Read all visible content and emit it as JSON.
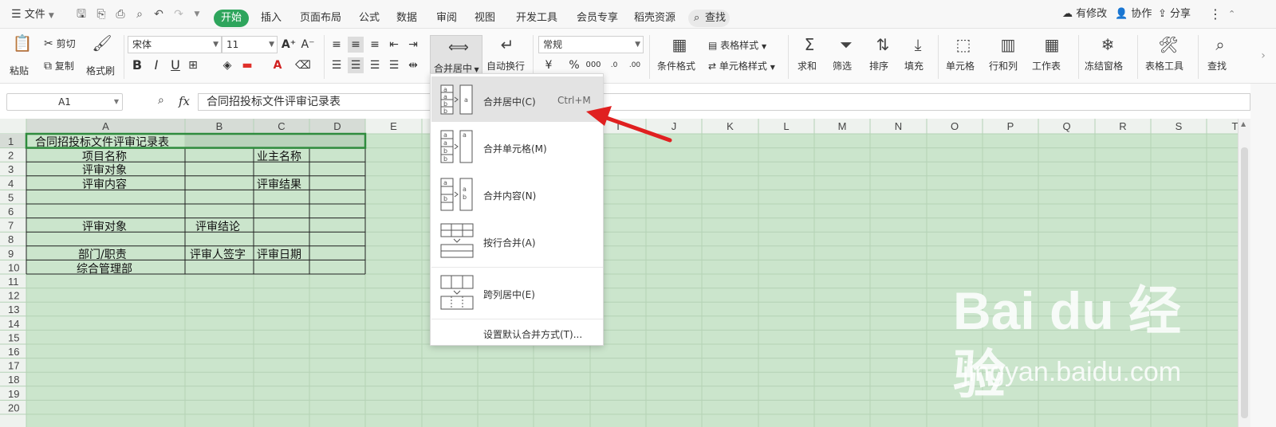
{
  "menubar": {
    "file_label": "文件",
    "tabs": [
      "插入",
      "页面布局",
      "公式",
      "数据",
      "审阅",
      "视图",
      "开发工具",
      "会员专享",
      "稻壳资源"
    ],
    "active_tab": "开始",
    "search_label": "查找",
    "changes_label": "有修改",
    "collab_label": "协作",
    "share_label": "分享"
  },
  "ribbon": {
    "paste": "粘贴",
    "cut": "剪切",
    "copy": "复制",
    "format_painter": "格式刷",
    "font_name": "宋体",
    "font_size": "11",
    "merge_center": "合并居中",
    "wrap_text": "自动换行",
    "number_format": "常规",
    "conditional_format": "条件格式",
    "table_style": "表格样式",
    "cell_style": "单元格样式",
    "sum": "求和",
    "filter": "筛选",
    "sort": "排序",
    "fill": "填充",
    "cells": "单元格",
    "rows_cols": "行和列",
    "worksheet": "工作表",
    "freeze": "冻结窗格",
    "table_tools": "表格工具",
    "find": "查找"
  },
  "formula_bar": {
    "cell_ref": "A1",
    "fx": "fx",
    "content": "合同招投标文件评审记录表"
  },
  "columns": [
    "A",
    "B",
    "C",
    "D",
    "E",
    "F",
    "G",
    "H",
    "I",
    "J",
    "K",
    "L",
    "M",
    "N",
    "O",
    "P",
    "Q",
    "R",
    "S",
    "T"
  ],
  "rows": [
    "1",
    "2",
    "3",
    "4",
    "5",
    "6",
    "7",
    "8",
    "9",
    "10",
    "11",
    "12",
    "13",
    "14",
    "15",
    "16",
    "17",
    "18",
    "19",
    "20"
  ],
  "cells": {
    "a1": "合同招投标文件评审记录表",
    "a2": "项目名称",
    "c2": "业主名称",
    "a3": "评审对象",
    "a4": "评审内容",
    "c4": "评审结果",
    "a7": "评审对象",
    "b7": "评审结论",
    "a9": "部门/职责",
    "b9": "评审人签字",
    "c9": "评审日期",
    "a10": "综合管理部"
  },
  "dropdown": {
    "items": [
      {
        "label": "合并居中(C)",
        "shortcut": "Ctrl+M"
      },
      {
        "label": "合并单元格(M)"
      },
      {
        "label": "合并内容(N)"
      },
      {
        "label": "按行合并(A)"
      },
      {
        "label": "跨列居中(E)"
      },
      {
        "label": "设置默认合并方式(T)..."
      }
    ]
  },
  "watermark": {
    "logo": "Bai du 经验",
    "url": "jingyan.baidu.com"
  },
  "colors": {
    "accent_green": "#2ea55c",
    "grid_green": "#cbe5cc",
    "arrow_red": "#e02020"
  }
}
